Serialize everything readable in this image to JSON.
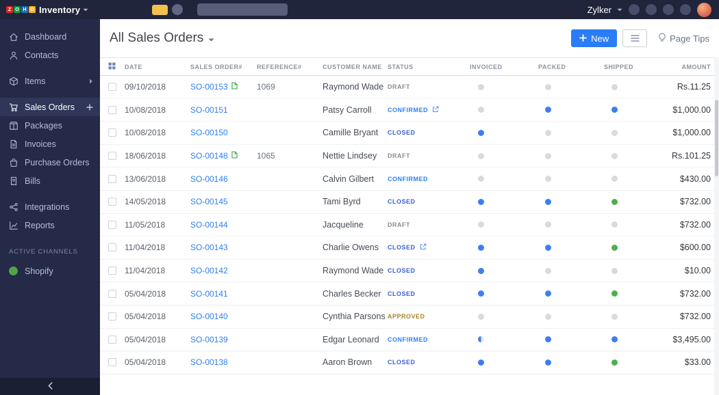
{
  "colors": {
    "topbar_bg": "#20253b",
    "sidebar_bg": "#242a47",
    "sidebar_footer_bg": "#1a1f33",
    "accent_blue": "#2b7cf7",
    "link_blue": "#2f80ed",
    "dot_gray": "#d8dadc",
    "dot_blue": "#3e7ef0",
    "dot_green": "#4caf50"
  },
  "topbar": {
    "brand": {
      "letters": [
        "Z",
        "O",
        "H",
        "O"
      ],
      "tile_colors": [
        "#e42527",
        "#089949",
        "#226db4",
        "#f9b21d"
      ],
      "product": "Inventory"
    },
    "org_name": "Zylker"
  },
  "sidebar": {
    "items": [
      "Dashboard",
      "Contacts",
      "Items",
      "Sales Orders",
      "Packages",
      "Invoices",
      "Purchase Orders",
      "Bills",
      "Integrations",
      "Reports"
    ],
    "channels_header": "ACTIVE CHANNELS",
    "channels": [
      "Shopify"
    ]
  },
  "header": {
    "title": "All Sales Orders",
    "new_label": "New",
    "page_tips": "Page Tips"
  },
  "table": {
    "columns": [
      "DATE",
      "SALES ORDER#",
      "REFERENCE#",
      "CUSTOMER NAME",
      "STATUS",
      "INVOICED",
      "PACKED",
      "SHIPPED",
      "AMOUNT"
    ],
    "status_colors": {
      "DRAFT": "#8c8c8c",
      "CONFIRMED": "#2f80ed",
      "CLOSED": "#3d61d2",
      "APPROVED": "#a8842c"
    },
    "rows": [
      {
        "date": "09/10/2018",
        "order": "SO-00153",
        "attachment": true,
        "reference": "1069",
        "customer": "Raymond Wade",
        "status": "DRAFT",
        "invoiced": "gray",
        "packed": "gray",
        "shipped": "gray",
        "amount": "Rs.11.25"
      },
      {
        "date": "10/08/2018",
        "order": "SO-00151",
        "reference": "",
        "customer": "Patsy Carroll",
        "status": "CONFIRMED",
        "share": true,
        "invoiced": "gray",
        "packed": "blue",
        "shipped": "blue",
        "amount": "$1,000.00"
      },
      {
        "date": "10/08/2018",
        "order": "SO-00150",
        "reference": "",
        "customer": "Camille Bryant",
        "status": "CLOSED",
        "invoiced": "blue",
        "packed": "gray",
        "shipped": "gray",
        "amount": "$1,000.00"
      },
      {
        "date": "18/06/2018",
        "order": "SO-00148",
        "attachment": true,
        "reference": "1065",
        "customer": "Nettie Lindsey",
        "status": "DRAFT",
        "invoiced": "gray",
        "packed": "gray",
        "shipped": "gray",
        "amount": "Rs.101.25"
      },
      {
        "date": "13/06/2018",
        "order": "SO-00146",
        "reference": "",
        "customer": "Calvin Gilbert",
        "status": "CONFIRMED",
        "invoiced": "gray",
        "packed": "gray",
        "shipped": "gray",
        "amount": "$430.00"
      },
      {
        "date": "14/05/2018",
        "order": "SO-00145",
        "reference": "",
        "customer": "Tami Byrd",
        "status": "CLOSED",
        "invoiced": "blue",
        "packed": "blue",
        "shipped": "green",
        "amount": "$732.00"
      },
      {
        "date": "11/05/2018",
        "order": "SO-00144",
        "reference": "",
        "customer": "Jacqueline",
        "status": "DRAFT",
        "invoiced": "gray",
        "packed": "gray",
        "shipped": "gray",
        "amount": "$732.00"
      },
      {
        "date": "11/04/2018",
        "order": "SO-00143",
        "reference": "",
        "customer": "Charlie Owens",
        "status": "CLOSED",
        "share": true,
        "invoiced": "blue",
        "packed": "blue",
        "shipped": "green",
        "amount": "$600.00"
      },
      {
        "date": "11/04/2018",
        "order": "SO-00142",
        "reference": "",
        "customer": "Raymond Wade",
        "status": "CLOSED",
        "invoiced": "blue",
        "packed": "gray",
        "shipped": "gray",
        "amount": "$10.00"
      },
      {
        "date": "05/04/2018",
        "order": "SO-00141",
        "reference": "",
        "customer": "Charles Becker",
        "status": "CLOSED",
        "invoiced": "blue",
        "packed": "blue",
        "shipped": "green",
        "amount": "$732.00"
      },
      {
        "date": "05/04/2018",
        "order": "SO-00140",
        "reference": "",
        "customer": "Cynthia Parsons",
        "status": "APPROVED",
        "invoiced": "gray",
        "packed": "gray",
        "shipped": "gray",
        "amount": "$732.00"
      },
      {
        "date": "05/04/2018",
        "order": "SO-00139",
        "reference": "",
        "customer": "Edgar Leonard",
        "status": "CONFIRMED",
        "invoiced": "half",
        "packed": "blue",
        "shipped": "blue",
        "amount": "$3,495.00"
      },
      {
        "date": "05/04/2018",
        "order": "SO-00138",
        "reference": "",
        "customer": "Aaron Brown",
        "status": "CLOSED",
        "invoiced": "blue",
        "packed": "blue",
        "shipped": "green",
        "amount": "$33.00"
      }
    ]
  }
}
